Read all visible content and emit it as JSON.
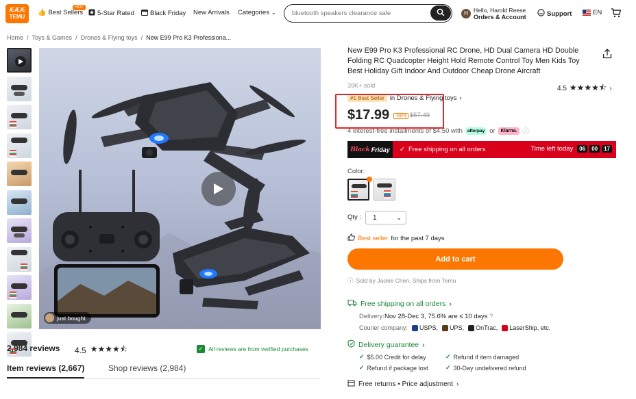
{
  "header": {
    "logo_text_top": "ÆÆÆ",
    "logo_text_bottom": "TEMU",
    "nav": [
      {
        "label": "Best Sellers",
        "badge": "HOT"
      },
      {
        "label": "5-Star Rated"
      },
      {
        "label": "Black Friday"
      },
      {
        "label": "New Arrivals"
      },
      {
        "label": "Categories"
      }
    ],
    "search_placeholder": "bluetooth speakers clearance sale",
    "account_greeting": "Hello, Harold Reese",
    "account_label": "Orders & Account",
    "avatar_letter": "H",
    "support_label": "Support",
    "language": "EN"
  },
  "breadcrumb": [
    "Home",
    "Toys & Games",
    "Drones & Flying toys",
    "New E99 Pro K3 Professiona..."
  ],
  "gallery": {
    "just_bought": "just bought"
  },
  "reviews": {
    "count_label": "2,984 reviews",
    "rating": "4.5",
    "stars": "★★★★⯪",
    "verified_text": "All reviews are from verified purchases",
    "tab_item": "Item reviews (2,667)",
    "tab_shop": "Shop reviews (2,984)"
  },
  "product": {
    "title": "New E99 Pro K3 Professional RC Drone, HD Dual Camera HD Double Folding RC Quadcopter Height Hold Remote Control Toy Men Kids Toy Best Holiday Gift Indoor And Outdoor Cheap Drone Aircraft",
    "sold": "39K+ sold",
    "rating": "4.5",
    "stars": "★★★★⯪",
    "best_badge": "#1 Best Seller",
    "best_category": "in Drones & Flying toys",
    "price": "$17.99",
    "discount": "-68%",
    "original_price": "$57.49",
    "installments_text": "4 interest-free installments of $4.50 with",
    "afterpay": "afterpay",
    "or": "or",
    "klarna": "Klarna."
  },
  "promo": {
    "logo_a": "Black",
    "logo_b": "Friday",
    "free_shipping": "Free shipping on all orders",
    "time_label": "Time left today",
    "hours": "06",
    "minutes": "00",
    "seconds": "17"
  },
  "options": {
    "color_label": "Color:",
    "qty_label": "Qty :",
    "qty_value": "1"
  },
  "best_seller": {
    "highlight": "Best seller",
    "rest": "for the past 7 days"
  },
  "add_to_cart": "Add to cart",
  "sold_by": "Sold by Jackie Chen, Ships from Temu",
  "shipping": {
    "title": "Free shipping on all orders",
    "delivery_key": "Delivery:",
    "delivery_value": "Nov 28-Dec 3, 75.6% are ≤ 10 days",
    "courier_key": "Courier company:",
    "couriers": [
      "USPS,",
      "UPS,",
      "OnTrac,",
      "LaserShip, etc."
    ]
  },
  "guarantee": {
    "title": "Delivery guarantee",
    "items": [
      "$5.00 Credit for delay",
      "Refund if item damaged",
      "Refund if package lost",
      "30-Day undelivered refund"
    ]
  },
  "returns": "Free returns • Price adjustment"
}
